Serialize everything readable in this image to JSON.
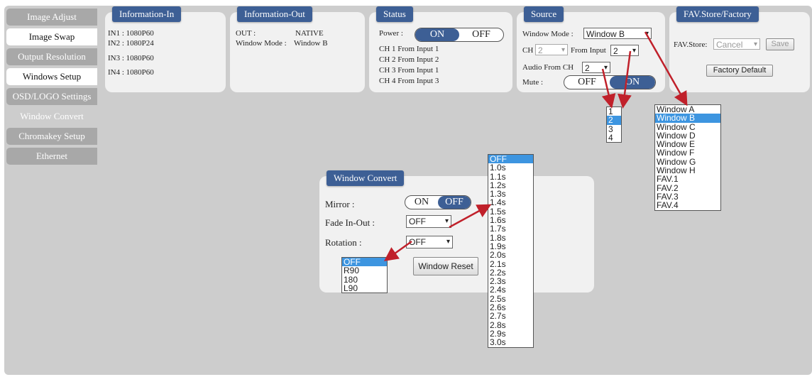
{
  "sidebar": {
    "items": [
      {
        "label": "Image Adjust"
      },
      {
        "label": "Image Swap"
      },
      {
        "label": "Output Resolution"
      },
      {
        "label": "Windows Setup"
      },
      {
        "label": "OSD/LOGO Settings"
      },
      {
        "label": "Window Convert"
      },
      {
        "label": "Chromakey Setup"
      },
      {
        "label": "Ethernet"
      }
    ]
  },
  "info_in": {
    "title": "Information-In",
    "lines": [
      "IN1 : 1080P60",
      "IN2 : 1080P24",
      "IN3 : 1080P60",
      "IN4 : 1080P60"
    ]
  },
  "info_out": {
    "title": "Information-Out",
    "out_label": "OUT :",
    "out_value": "NATIVE",
    "mode_label": "Window Mode :",
    "mode_value": "Window B"
  },
  "status": {
    "title": "Status",
    "power_label": "Power :",
    "on": "ON",
    "off": "OFF",
    "channels": [
      "CH 1 From Input  1",
      "CH 2 From Input  2",
      "CH 3 From Input  1",
      "CH 4 From Input  3"
    ]
  },
  "source": {
    "title": "Source",
    "window_mode_label": "Window Mode :",
    "window_mode_value": "Window B",
    "ch_label": "CH",
    "ch_value": "2",
    "from_input_label": "From Input",
    "from_input_value": "2",
    "audio_label": "Audio From CH",
    "audio_value": "2",
    "mute_label": "Mute :",
    "off": "OFF",
    "on": "ON"
  },
  "fav": {
    "title": "FAV.Store/Factory",
    "store_label": "FAV.Store:",
    "store_value": "Cancel",
    "save": "Save",
    "factory_default": "Factory Default"
  },
  "window_convert": {
    "title": "Window Convert",
    "mirror_label": "Mirror :",
    "on": "ON",
    "off": "OFF",
    "fade_label": "Fade In-Out :",
    "fade_value": "OFF",
    "rotation_label": "Rotation :",
    "rotation_value": "OFF",
    "reset": "Window Reset"
  },
  "input_list": {
    "options": [
      "1",
      "2",
      "3",
      "4"
    ],
    "selected": "2"
  },
  "window_list": {
    "options": [
      "Window A",
      "Window B",
      "Window C",
      "Window D",
      "Window E",
      "Window F",
      "Window G",
      "Window H",
      "FAV.1",
      "FAV.2",
      "FAV.3",
      "FAV.4"
    ],
    "selected": "Window B"
  },
  "fade_list": {
    "options": [
      "OFF",
      "1.0s",
      "1.1s",
      "1.2s",
      "1.3s",
      "1.4s",
      "1.5s",
      "1.6s",
      "1.7s",
      "1.8s",
      "1.9s",
      "2.0s",
      "2.1s",
      "2.2s",
      "2.3s",
      "2.4s",
      "2.5s",
      "2.6s",
      "2.7s",
      "2.8s",
      "2.9s",
      "3.0s"
    ],
    "selected": "OFF"
  },
  "rotation_list": {
    "options": [
      "OFF",
      "R90",
      "180",
      "L90"
    ],
    "selected": "OFF"
  },
  "colors": {
    "accent": "#3d5f95",
    "highlight": "#3d95e0",
    "arrow": "#c0202a"
  }
}
